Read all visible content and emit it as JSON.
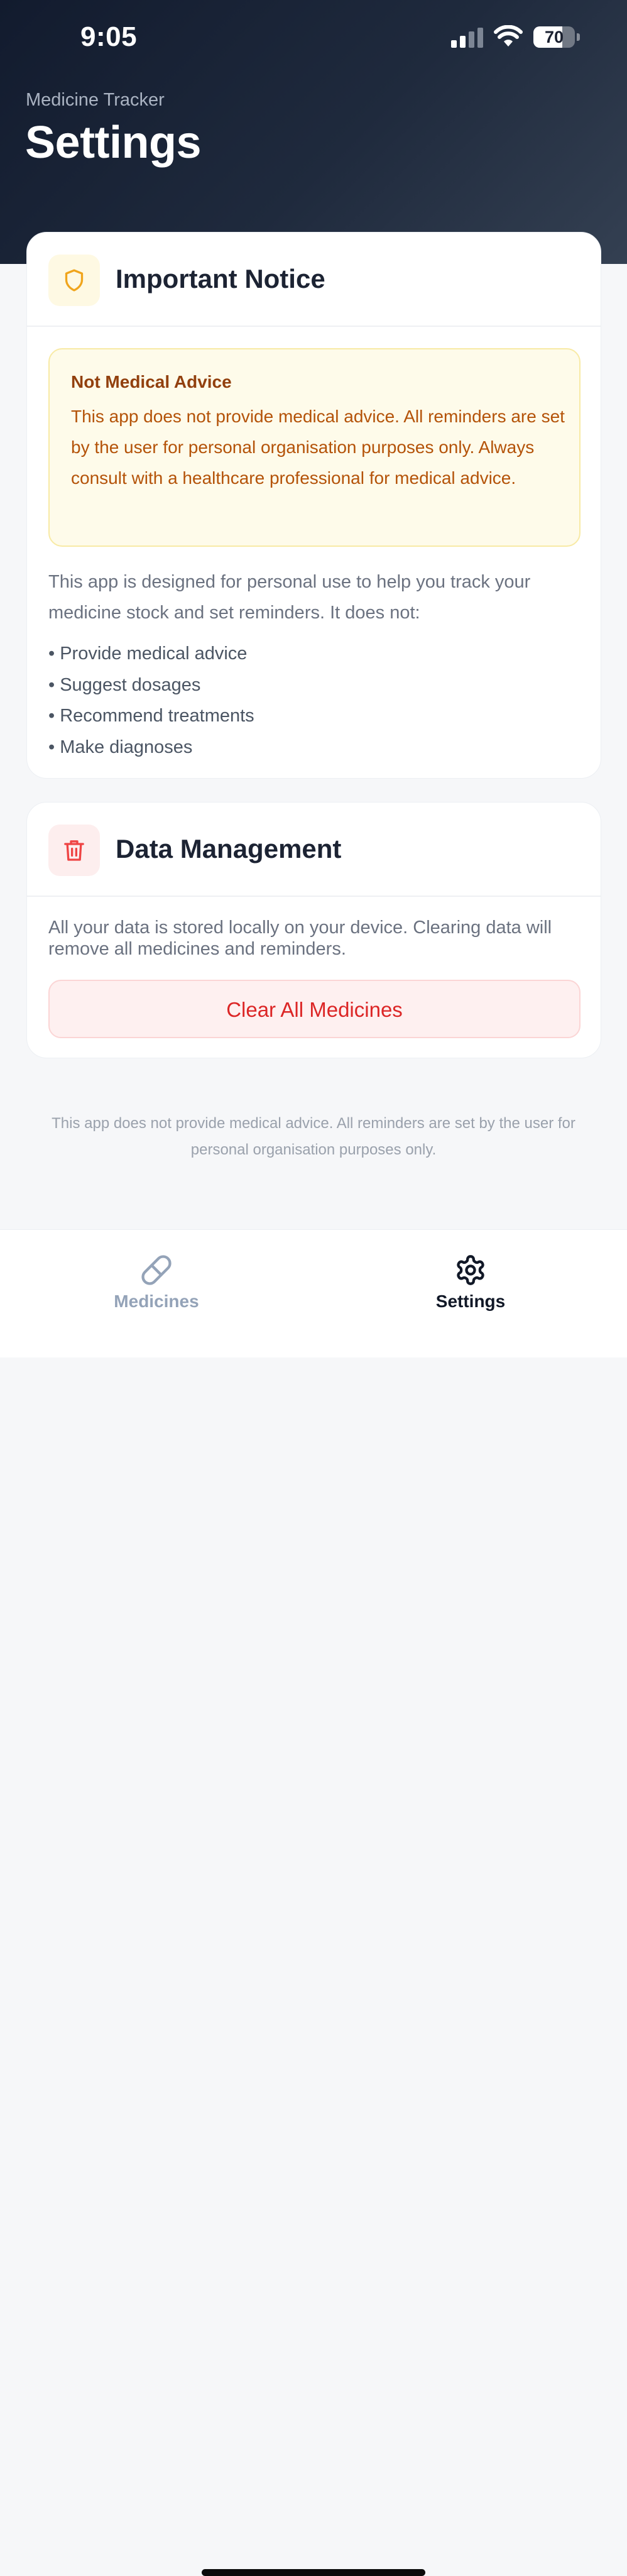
{
  "status_bar": {
    "time": "9:05",
    "battery_level": "70",
    "battery_fraction": 0.7
  },
  "header": {
    "app_name": "Medicine Tracker",
    "title": "Settings"
  },
  "notice_card": {
    "icon": "shield-icon",
    "title": "Important Notice",
    "alert_title": "Not Medical Advice",
    "alert_body": "This app does not provide medical advice. All reminders are set by the user for personal organisation purposes only. Always consult with a healthcare professional for medical advice.",
    "intro": "This app is designed for personal use to help you track your medicine stock and set reminders. It does not:",
    "bullets": [
      "• Provide medical advice",
      "• Suggest dosages",
      "• Recommend treatments",
      "• Make diagnoses"
    ]
  },
  "data_card": {
    "icon": "trash-icon",
    "title": "Data Management",
    "description": "All your data is stored locally on your device. Clearing data will remove all medicines and reminders.",
    "clear_button_label": "Clear All Medicines"
  },
  "footer": {
    "note": "This app does not provide medical advice. All reminders are set by the user for personal organisation purposes only."
  },
  "tab_bar": {
    "tabs": [
      {
        "label": "Medicines",
        "icon": "pill-icon",
        "active": false
      },
      {
        "label": "Settings",
        "icon": "gear-icon",
        "active": true
      }
    ]
  },
  "colors": {
    "header_dark": "#121b2e",
    "warning_text": "#b45309",
    "warning_bg": "#fefbea",
    "danger": "#dc2626",
    "accent_shield": "#f0a51c"
  }
}
